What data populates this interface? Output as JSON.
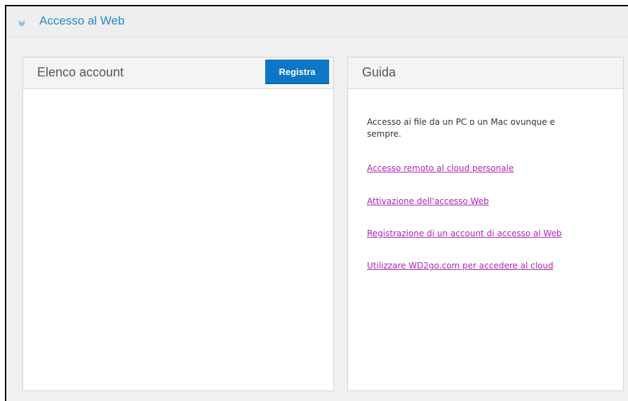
{
  "section": {
    "title": "Accesso al Web",
    "icon": "chevron-down-icon"
  },
  "accounts_panel": {
    "title": "Elenco account",
    "register_label": "Registra"
  },
  "guide_panel": {
    "title": "Guida",
    "description": "Accesso ai file da un PC o un Mac ovunque e sempre.",
    "links": [
      "Accesso remoto al cloud personale",
      "Attivazione dell'accesso Web",
      "Registrazione di un account di accesso al Web",
      "Utilizzare WD2go.com per accedere al cloud"
    ]
  },
  "colors": {
    "accent": "#1f8ccf",
    "button": "#0c77c6",
    "link": "#b023b9"
  }
}
